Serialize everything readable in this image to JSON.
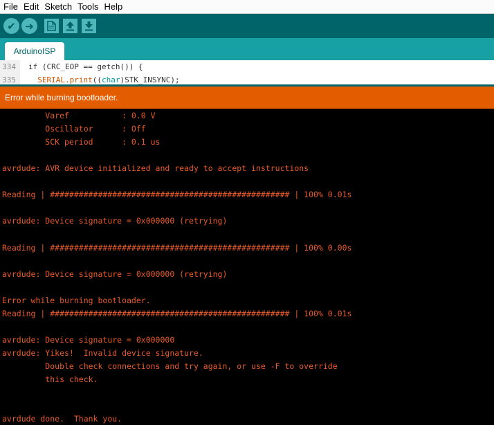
{
  "menubar": {
    "items": [
      "File",
      "Edit",
      "Sketch",
      "Tools",
      "Help"
    ]
  },
  "toolbar": {
    "buttons": [
      {
        "name": "verify",
        "glyph": "✔"
      },
      {
        "name": "upload",
        "glyph": "➜"
      },
      {
        "name": "new"
      },
      {
        "name": "open"
      },
      {
        "name": "save"
      }
    ]
  },
  "tabs": [
    {
      "label": "ArduinoISP"
    }
  ],
  "editor": {
    "lines": [
      {
        "number": "334",
        "code_pre": "if (CRC_EOP == getch()) {",
        "code_fn": "",
        "code_kw": "",
        "code_post": ""
      },
      {
        "number": "335",
        "code_pre": "  ",
        "code_fn": "SERIAL.print",
        "code_mid": "((",
        "code_kw": "char",
        "code_post": ")STK_INSYNC);"
      }
    ]
  },
  "status": {
    "message": "Error while burning bootloader."
  },
  "console": {
    "lines": [
      "         Varef           : 0.0 V",
      "         Oscillator      : Off",
      "         SCK period      : 0.1 us",
      "",
      "avrdude: AVR device initialized and ready to accept instructions",
      "",
      "Reading | ################################################## | 100% 0.01s",
      "",
      "avrdude: Device signature = 0x000000 (retrying)",
      "",
      "Reading | ################################################## | 100% 0.00s",
      "",
      "avrdude: Device signature = 0x000000 (retrying)",
      "",
      "Error while burning bootloader.",
      "Reading | ################################################## | 100% 0.01s",
      "",
      "avrdude: Device signature = 0x000000",
      "avrdude: Yikes!  Invalid device signature.",
      "         Double check connections and try again, or use -F to override",
      "         this check.",
      "",
      "",
      "avrdude done.  Thank you."
    ]
  },
  "colors": {
    "toolbar_bg": "#006468",
    "tab_bar_bg": "#17a1a5",
    "status_bg": "#e35c00",
    "console_text": "#e85a2b"
  }
}
